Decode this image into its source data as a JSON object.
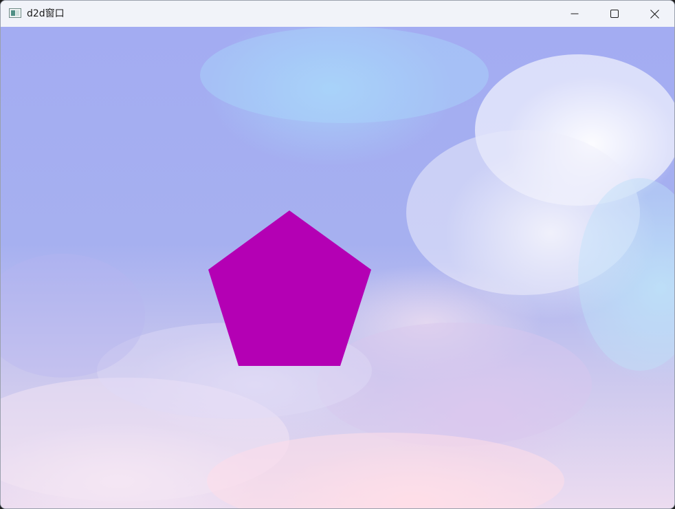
{
  "window": {
    "title": "d2d窗口",
    "icon": "app-window-icon"
  },
  "caption_buttons": {
    "minimize_icon": "minimize-icon",
    "maximize_icon": "maximize-icon",
    "close_icon": "close-icon"
  },
  "canvas": {
    "background": "pastel-sky-clouds",
    "shape": {
      "type": "pentagon",
      "fill_color": "#b400b4"
    }
  }
}
